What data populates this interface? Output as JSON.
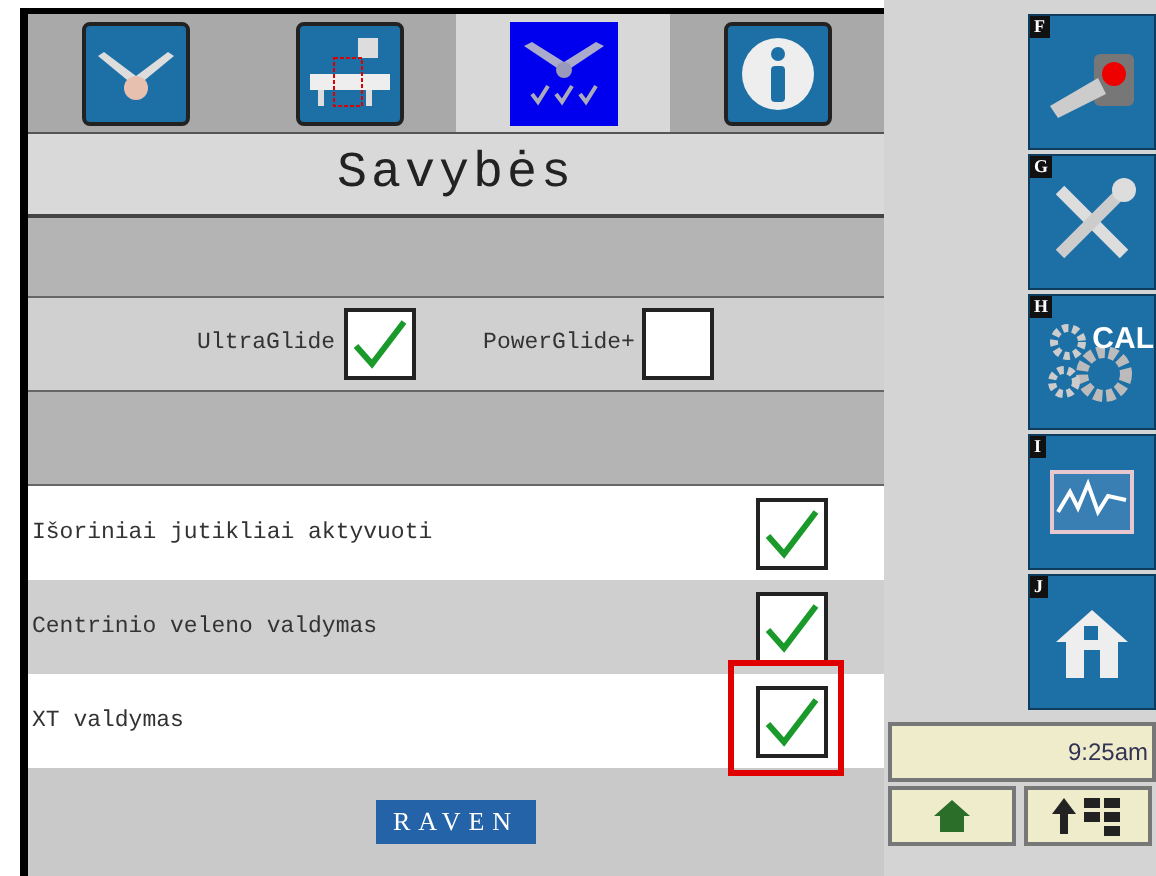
{
  "tabs": [
    {
      "kind": "boom",
      "selected": false
    },
    {
      "kind": "plumbing",
      "selected": false
    },
    {
      "kind": "features",
      "selected": true
    },
    {
      "kind": "info",
      "selected": false
    }
  ],
  "title": "Savybės",
  "glide_options": [
    {
      "label": "UltraGlide",
      "checked": true
    },
    {
      "label": "PowerGlide+",
      "checked": false
    }
  ],
  "features": [
    {
      "label": "Išoriniai jutikliai aktyvuoti",
      "checked": true,
      "highlighted": false
    },
    {
      "label": "Centrinio veleno valdymas",
      "checked": true,
      "highlighted": false
    },
    {
      "label": "XT valdymas",
      "checked": true,
      "highlighted": true
    }
  ],
  "logo": "RAVEN",
  "side_keys": [
    {
      "key": "F",
      "kind": "sensor"
    },
    {
      "key": "G",
      "kind": "tools"
    },
    {
      "key": "H",
      "kind": "calibration",
      "caption": "CAL"
    },
    {
      "key": "I",
      "kind": "diagnostics"
    },
    {
      "key": "J",
      "kind": "home"
    }
  ],
  "time": "9:25am",
  "bottom_buttons": [
    {
      "kind": "home"
    },
    {
      "kind": "up-grid"
    }
  ]
}
